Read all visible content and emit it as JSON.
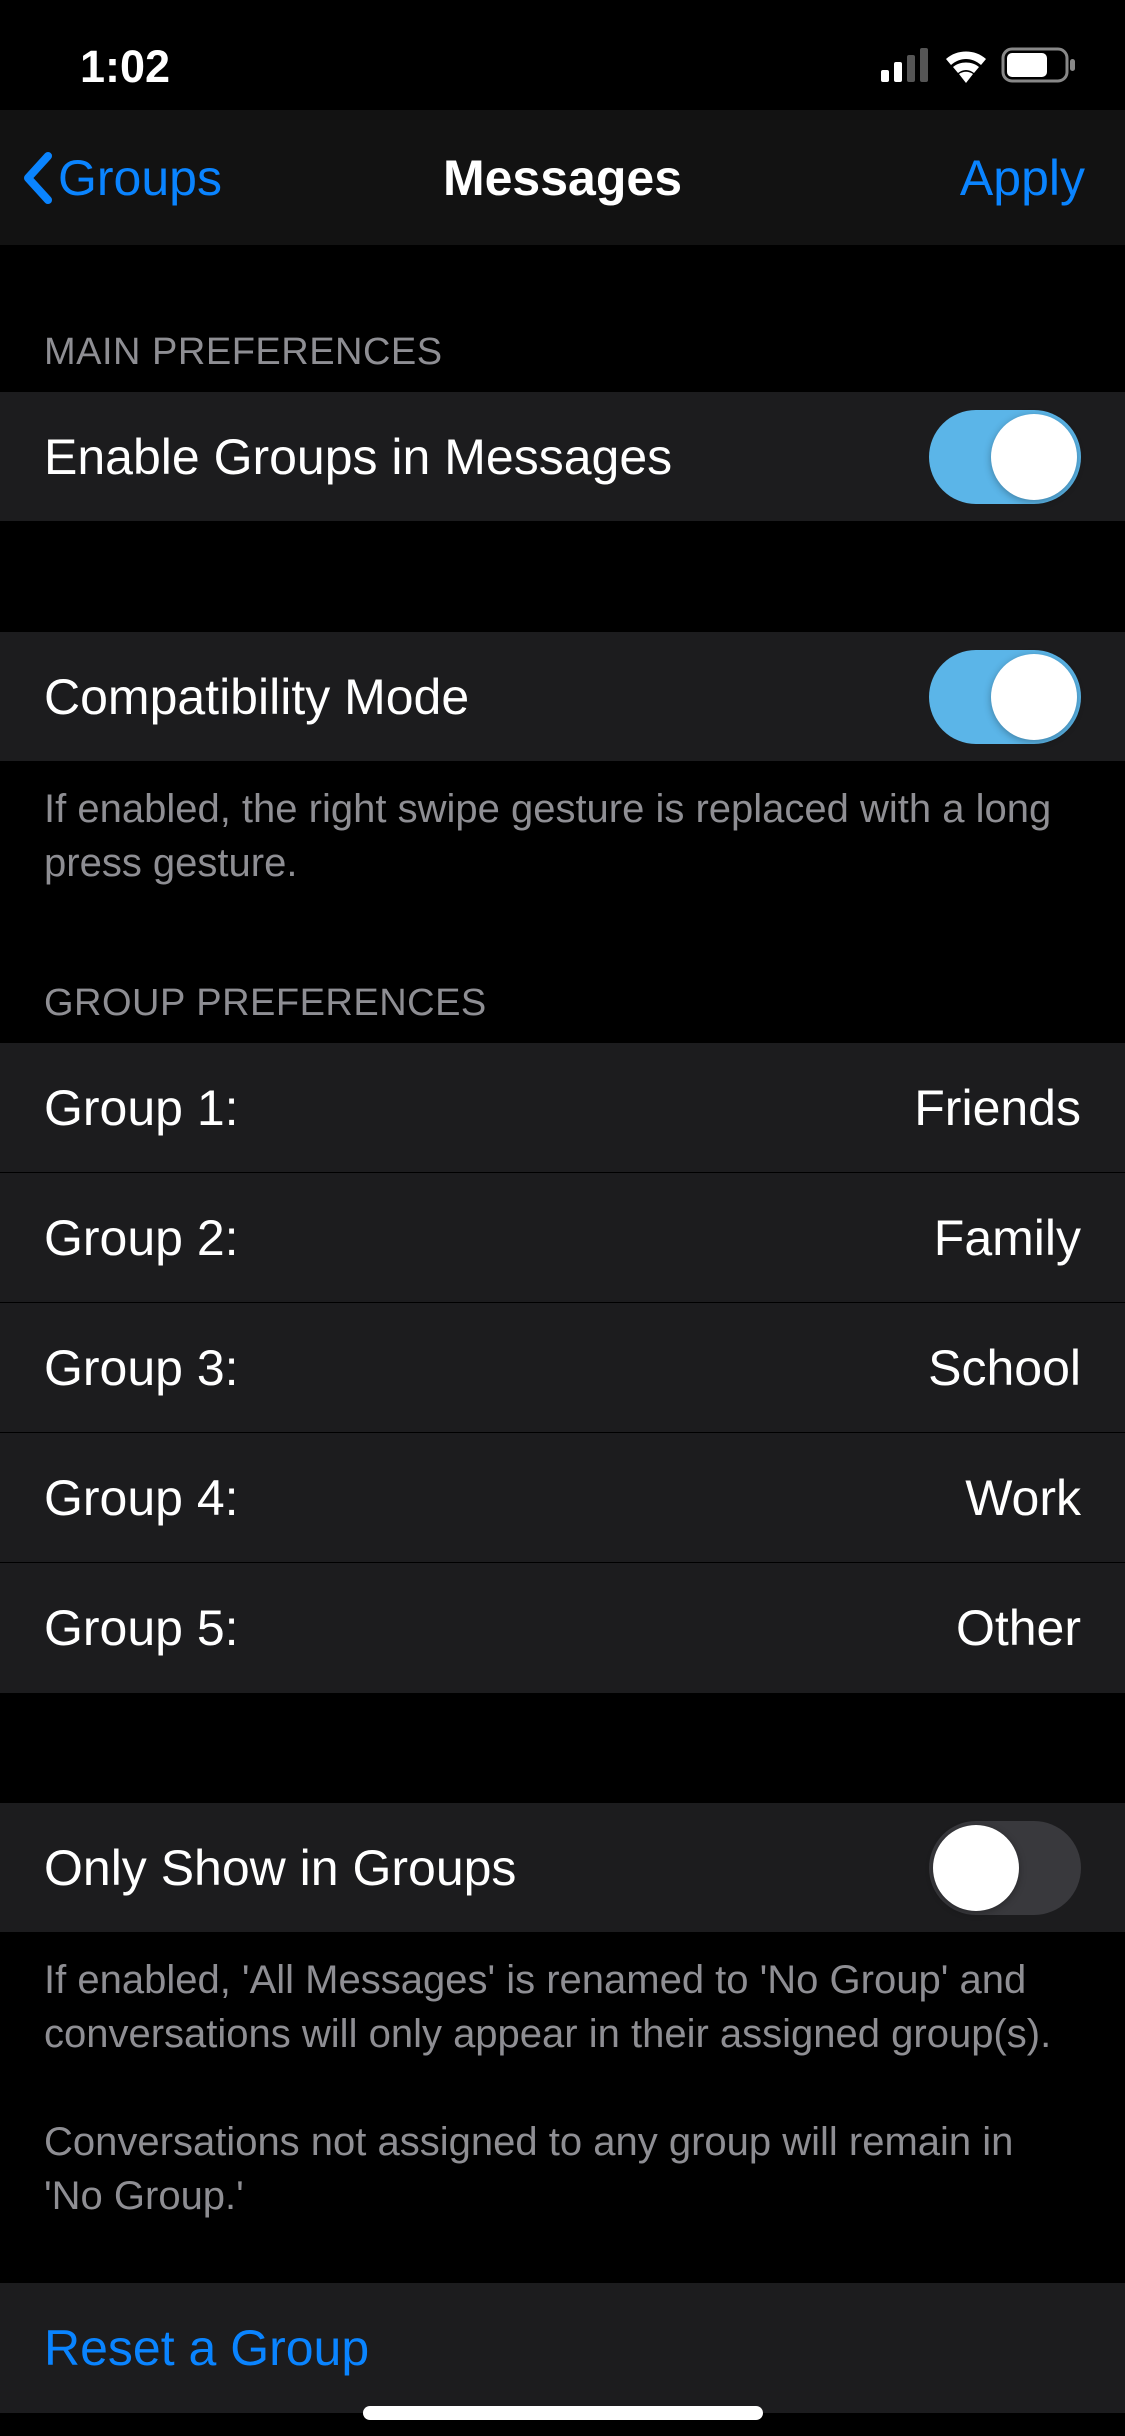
{
  "status": {
    "time": "1:02"
  },
  "nav": {
    "back_label": "Groups",
    "title": "Messages",
    "apply_label": "Apply"
  },
  "headers": {
    "main": "MAIN PREFERENCES",
    "group": "GROUP PREFERENCES"
  },
  "prefs": {
    "enable_groups_label": "Enable Groups in Messages",
    "compat_mode_label": "Compatibility Mode",
    "compat_footer": "If enabled, the right swipe gesture is replaced with a long press gesture.",
    "only_show_label": "Only Show in Groups",
    "only_show_footer": "If enabled, 'All Messages' is renamed to 'No Group' and conversations will only appear in their assigned group(s).\n\nConversations not assigned to any group will remain in 'No Group.'",
    "reset_label": "Reset a Group"
  },
  "groups": [
    {
      "key": "Group 1:",
      "value": "Friends"
    },
    {
      "key": "Group 2:",
      "value": "Family"
    },
    {
      "key": "Group 3:",
      "value": "School"
    },
    {
      "key": "Group 4:",
      "value": "Work"
    },
    {
      "key": "Group 5:",
      "value": "Other"
    }
  ],
  "colors": {
    "accent": "#0a84ff",
    "toggle_on": "#5bb5e8"
  }
}
